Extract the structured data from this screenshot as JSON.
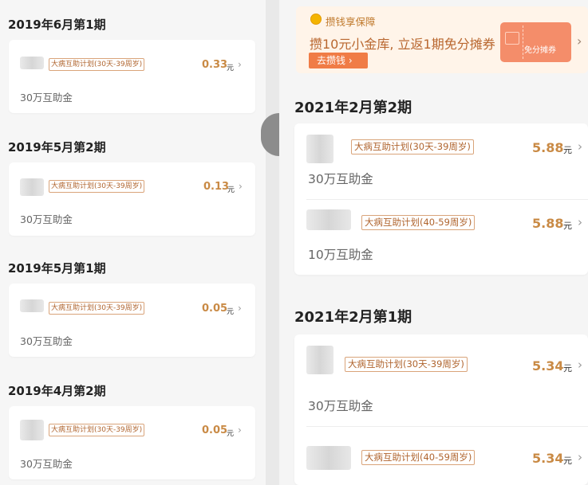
{
  "left_column": {
    "periods": [
      {
        "title": "2019年6月第1期",
        "plan_tag": "大病互助计划(30天-39周岁)",
        "amount": "0.33",
        "unit": "元",
        "coverage": "30万互助金"
      },
      {
        "title": "2019年5月第2期",
        "plan_tag": "大病互助计划(30天-39周岁)",
        "amount": "0.13",
        "unit": "元",
        "coverage": "30万互助金"
      },
      {
        "title": "2019年5月第1期",
        "plan_tag": "大病互助计划(30天-39周岁)",
        "amount": "0.05",
        "unit": "元",
        "coverage": "30万互助金"
      },
      {
        "title": "2019年4月第2期",
        "plan_tag": "大病互助计划(30天-39周岁)",
        "amount": "0.05",
        "unit": "元",
        "coverage": "30万互助金"
      }
    ]
  },
  "right_column": {
    "promo": {
      "title": "攒钱享保障",
      "text": "攒10元小金库, 立返1期免分摊券",
      "button_label": "去攒钱 ›",
      "ticket_label": "免分摊券"
    },
    "periods": [
      {
        "title": "2021年2月第2期",
        "rows": [
          {
            "plan_tag": "大病互助计划(30天-39周岁)",
            "amount": "5.88",
            "unit": "元",
            "coverage": "30万互助金"
          },
          {
            "plan_tag": "大病互助计划(40-59周岁)",
            "amount": "5.88",
            "unit": "元",
            "coverage": "10万互助金"
          }
        ]
      },
      {
        "title": "2021年2月第1期",
        "rows": [
          {
            "plan_tag": "大病互助计划(30天-39周岁)",
            "amount": "5.34",
            "unit": "元",
            "coverage": "30万互助金"
          },
          {
            "plan_tag": "大病互助计划(40-59周岁)",
            "amount": "5.34",
            "unit": "元",
            "coverage": ""
          }
        ]
      }
    ]
  },
  "icons": {
    "chevron": "›"
  },
  "colors": {
    "amount": "#c98a45",
    "tag_border": "#d9a47a",
    "promo_button": "#f07c46",
    "ticket": "#f48d6a"
  }
}
